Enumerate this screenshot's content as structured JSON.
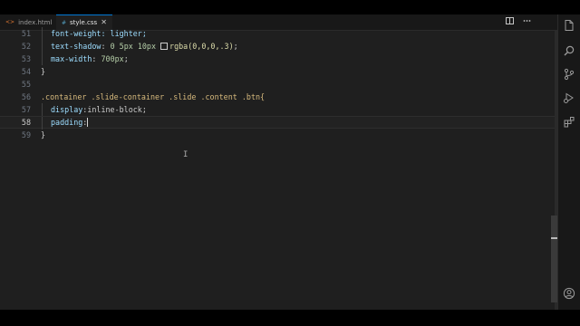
{
  "tabs": [
    {
      "label": "index.html",
      "icon": "html-file-icon",
      "active": false
    },
    {
      "label": "style.css",
      "icon": "css-file-icon",
      "active": true
    }
  ],
  "tab_close_glyph": "✕",
  "editor": {
    "lines": [
      {
        "number": "51",
        "text": "font-weight: lighter;"
      },
      {
        "number": "52",
        "text_parts": [
          "text-shadow",
          ": ",
          "0 5px 10px",
          " ",
          "rgba(0,0,0,.3)",
          ";"
        ]
      },
      {
        "number": "53",
        "text_parts": [
          "max-width",
          ": ",
          "700px",
          ";"
        ]
      },
      {
        "number": "54",
        "text": "}"
      },
      {
        "number": "55",
        "text": ""
      },
      {
        "number": "56",
        "text": ".container .slide-container .slide .content .btn{"
      },
      {
        "number": "57",
        "text_parts": [
          "display",
          ":",
          "inline-block",
          ";"
        ]
      },
      {
        "number": "58",
        "text_parts": [
          "padding",
          ":"
        ]
      },
      {
        "number": "59",
        "text": "}"
      }
    ]
  },
  "colors": {
    "background": "#1f1f1f",
    "property": "#9cdcfe",
    "number": "#b5cea8",
    "selector": "#d7ba7d",
    "accent": "#0078d4"
  },
  "activity_icons": [
    "files-icon",
    "search-icon",
    "source-control-icon",
    "run-debug-icon",
    "extensions-icon",
    "account-icon"
  ],
  "toolbar_icons": [
    "split-editor-icon",
    "more-actions-icon"
  ]
}
